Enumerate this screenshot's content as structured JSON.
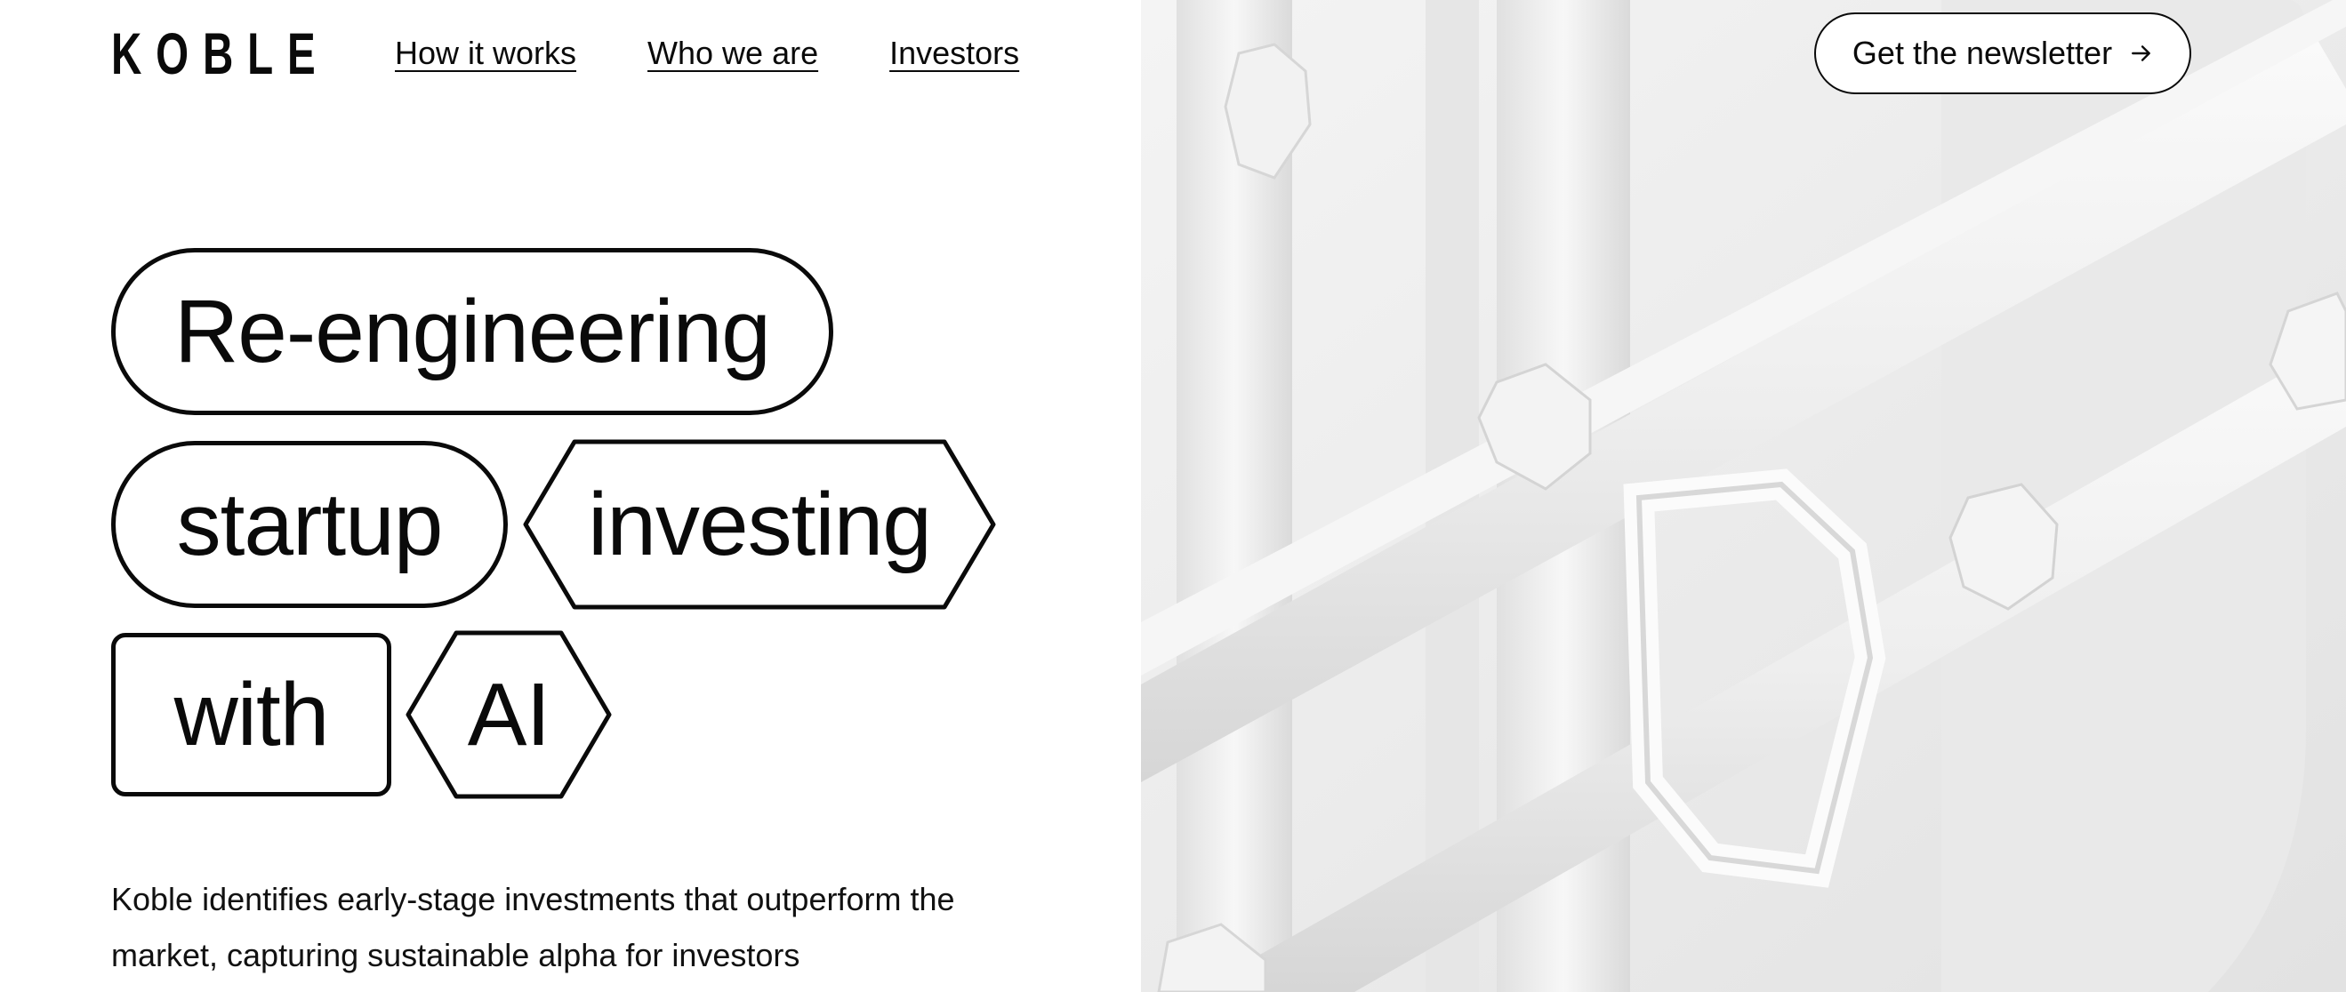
{
  "brand": {
    "logo_text": "KOBLE"
  },
  "nav": {
    "items": [
      {
        "label": "How it works"
      },
      {
        "label": "Who we are"
      },
      {
        "label": "Investors"
      }
    ]
  },
  "cta": {
    "newsletter_label": "Get the newsletter",
    "icon": "arrow-right-icon"
  },
  "hero": {
    "words": [
      "Re-engineering",
      "startup",
      "investing",
      "with",
      "AI"
    ],
    "description": "Koble identifies early-stage investments that outperform the market, capturing sustainable alpha for investors"
  },
  "image": {
    "description_icon": "abstract-3d-chain-render"
  },
  "colors": {
    "text": "#0a0a0a",
    "background": "#ffffff",
    "image_bg": "#ececec"
  }
}
